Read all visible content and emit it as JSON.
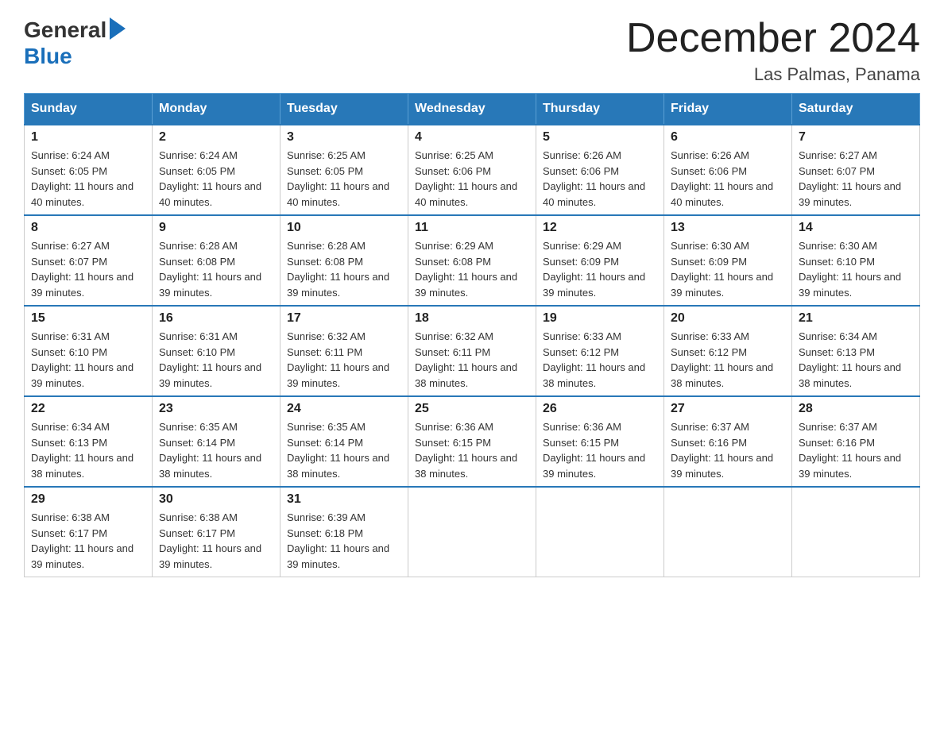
{
  "header": {
    "logo_general": "General",
    "logo_blue": "Blue",
    "title": "December 2024",
    "subtitle": "Las Palmas, Panama"
  },
  "columns": [
    "Sunday",
    "Monday",
    "Tuesday",
    "Wednesday",
    "Thursday",
    "Friday",
    "Saturday"
  ],
  "weeks": [
    [
      {
        "day": "1",
        "sunrise": "6:24 AM",
        "sunset": "6:05 PM",
        "daylight": "11 hours and 40 minutes."
      },
      {
        "day": "2",
        "sunrise": "6:24 AM",
        "sunset": "6:05 PM",
        "daylight": "11 hours and 40 minutes."
      },
      {
        "day": "3",
        "sunrise": "6:25 AM",
        "sunset": "6:05 PM",
        "daylight": "11 hours and 40 minutes."
      },
      {
        "day": "4",
        "sunrise": "6:25 AM",
        "sunset": "6:06 PM",
        "daylight": "11 hours and 40 minutes."
      },
      {
        "day": "5",
        "sunrise": "6:26 AM",
        "sunset": "6:06 PM",
        "daylight": "11 hours and 40 minutes."
      },
      {
        "day": "6",
        "sunrise": "6:26 AM",
        "sunset": "6:06 PM",
        "daylight": "11 hours and 40 minutes."
      },
      {
        "day": "7",
        "sunrise": "6:27 AM",
        "sunset": "6:07 PM",
        "daylight": "11 hours and 39 minutes."
      }
    ],
    [
      {
        "day": "8",
        "sunrise": "6:27 AM",
        "sunset": "6:07 PM",
        "daylight": "11 hours and 39 minutes."
      },
      {
        "day": "9",
        "sunrise": "6:28 AM",
        "sunset": "6:08 PM",
        "daylight": "11 hours and 39 minutes."
      },
      {
        "day": "10",
        "sunrise": "6:28 AM",
        "sunset": "6:08 PM",
        "daylight": "11 hours and 39 minutes."
      },
      {
        "day": "11",
        "sunrise": "6:29 AM",
        "sunset": "6:08 PM",
        "daylight": "11 hours and 39 minutes."
      },
      {
        "day": "12",
        "sunrise": "6:29 AM",
        "sunset": "6:09 PM",
        "daylight": "11 hours and 39 minutes."
      },
      {
        "day": "13",
        "sunrise": "6:30 AM",
        "sunset": "6:09 PM",
        "daylight": "11 hours and 39 minutes."
      },
      {
        "day": "14",
        "sunrise": "6:30 AM",
        "sunset": "6:10 PM",
        "daylight": "11 hours and 39 minutes."
      }
    ],
    [
      {
        "day": "15",
        "sunrise": "6:31 AM",
        "sunset": "6:10 PM",
        "daylight": "11 hours and 39 minutes."
      },
      {
        "day": "16",
        "sunrise": "6:31 AM",
        "sunset": "6:10 PM",
        "daylight": "11 hours and 39 minutes."
      },
      {
        "day": "17",
        "sunrise": "6:32 AM",
        "sunset": "6:11 PM",
        "daylight": "11 hours and 39 minutes."
      },
      {
        "day": "18",
        "sunrise": "6:32 AM",
        "sunset": "6:11 PM",
        "daylight": "11 hours and 38 minutes."
      },
      {
        "day": "19",
        "sunrise": "6:33 AM",
        "sunset": "6:12 PM",
        "daylight": "11 hours and 38 minutes."
      },
      {
        "day": "20",
        "sunrise": "6:33 AM",
        "sunset": "6:12 PM",
        "daylight": "11 hours and 38 minutes."
      },
      {
        "day": "21",
        "sunrise": "6:34 AM",
        "sunset": "6:13 PM",
        "daylight": "11 hours and 38 minutes."
      }
    ],
    [
      {
        "day": "22",
        "sunrise": "6:34 AM",
        "sunset": "6:13 PM",
        "daylight": "11 hours and 38 minutes."
      },
      {
        "day": "23",
        "sunrise": "6:35 AM",
        "sunset": "6:14 PM",
        "daylight": "11 hours and 38 minutes."
      },
      {
        "day": "24",
        "sunrise": "6:35 AM",
        "sunset": "6:14 PM",
        "daylight": "11 hours and 38 minutes."
      },
      {
        "day": "25",
        "sunrise": "6:36 AM",
        "sunset": "6:15 PM",
        "daylight": "11 hours and 38 minutes."
      },
      {
        "day": "26",
        "sunrise": "6:36 AM",
        "sunset": "6:15 PM",
        "daylight": "11 hours and 39 minutes."
      },
      {
        "day": "27",
        "sunrise": "6:37 AM",
        "sunset": "6:16 PM",
        "daylight": "11 hours and 39 minutes."
      },
      {
        "day": "28",
        "sunrise": "6:37 AM",
        "sunset": "6:16 PM",
        "daylight": "11 hours and 39 minutes."
      }
    ],
    [
      {
        "day": "29",
        "sunrise": "6:38 AM",
        "sunset": "6:17 PM",
        "daylight": "11 hours and 39 minutes."
      },
      {
        "day": "30",
        "sunrise": "6:38 AM",
        "sunset": "6:17 PM",
        "daylight": "11 hours and 39 minutes."
      },
      {
        "day": "31",
        "sunrise": "6:39 AM",
        "sunset": "6:18 PM",
        "daylight": "11 hours and 39 minutes."
      },
      null,
      null,
      null,
      null
    ]
  ],
  "labels": {
    "sunrise": "Sunrise:",
    "sunset": "Sunset:",
    "daylight": "Daylight:"
  }
}
